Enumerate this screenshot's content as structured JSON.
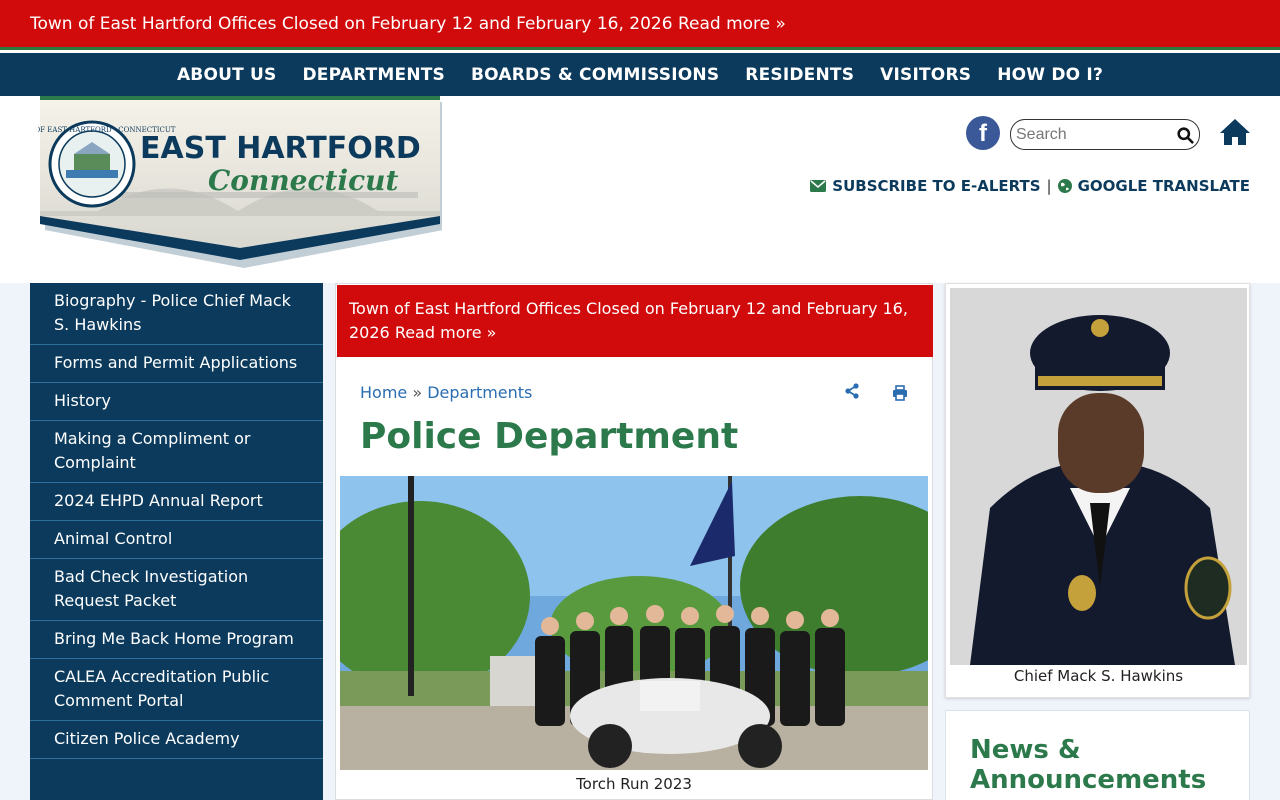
{
  "alert": {
    "text": "Town of East Hartford Offices Closed on February 12 and February 16, 2026",
    "link": "Read more »"
  },
  "nav": {
    "items": [
      "ABOUT US",
      "DEPARTMENTS",
      "BOARDS & COMMISSIONS",
      "RESIDENTS",
      "VISITORS",
      "HOW DO I?"
    ]
  },
  "logo": {
    "line1": "EAST HARTFORD",
    "line2": "Connecticut",
    "seal_text": "TOWN OF EAST HARTFORD · CONNECTICUT"
  },
  "search": {
    "placeholder": "Search"
  },
  "utility": {
    "subscribe": "SUBSCRIBE TO E-ALERTS",
    "separator": "|",
    "translate": "GOOGLE TRANSLATE"
  },
  "sidebar": {
    "items": [
      "Biography - Police Chief Mack S. Hawkins",
      "Forms and Permit Applications",
      "History",
      "Making a Compliment or Complaint",
      "2024 EHPD Annual Report",
      "Animal Control",
      "Bad Check Investigation Request Packet",
      "Bring Me Back Home Program",
      "CALEA Accreditation Public Comment Portal",
      "Citizen Police Academy"
    ]
  },
  "main": {
    "breadcrumb": {
      "home": "Home",
      "sep": "»",
      "current": "Departments"
    },
    "title": "Police Department",
    "hero_caption": "Torch Run 2023"
  },
  "chief": {
    "caption": "Chief Mack S. Hawkins"
  },
  "news": {
    "title": "News & Announcements"
  },
  "colors": {
    "alert_red": "#d10b0b",
    "navy": "#0b3a5c",
    "green": "#2c7a4b",
    "link_blue": "#2a6db0"
  }
}
